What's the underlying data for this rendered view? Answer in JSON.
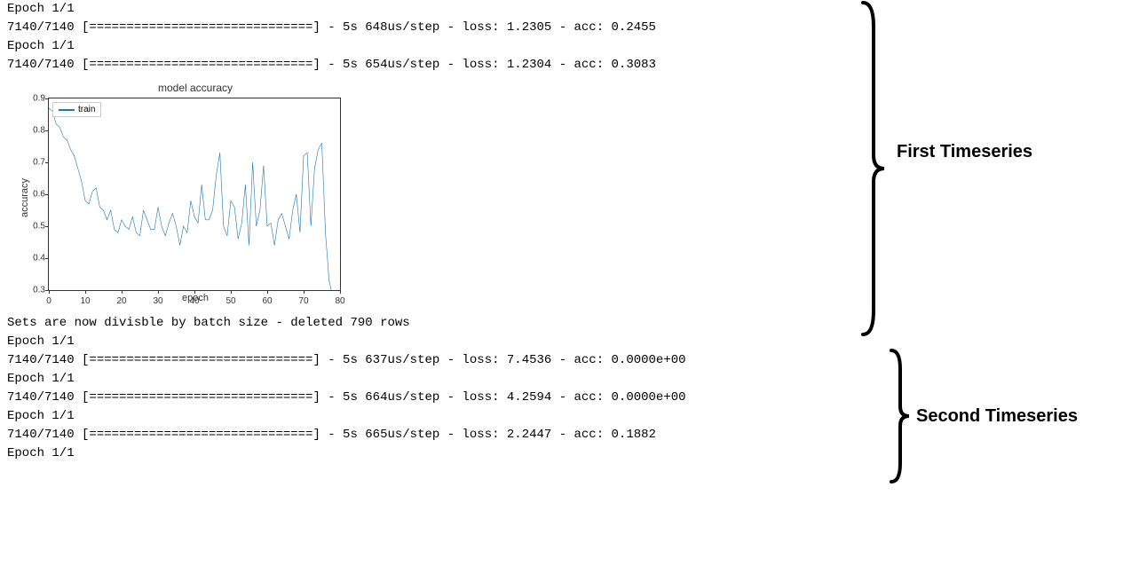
{
  "console": {
    "first_ts": [
      "Epoch 1/1",
      "7140/7140 [==============================] - 5s 648us/step - loss: 1.2305 - acc: 0.2455",
      "Epoch 1/1",
      "7140/7140 [==============================] - 5s 654us/step - loss: 1.2304 - acc: 0.3083"
    ],
    "second_ts": [
      "Sets are now divisble by batch size - deleted 790 rows",
      "Epoch 1/1",
      "7140/7140 [==============================] - 5s 637us/step - loss: 7.4536 - acc: 0.0000e+00",
      "Epoch 1/1",
      "7140/7140 [==============================] - 5s 664us/step - loss: 4.2594 - acc: 0.0000e+00",
      "Epoch 1/1",
      "7140/7140 [==============================] - 5s 665us/step - loss: 2.2447 - acc: 0.1882",
      "Epoch 1/1"
    ]
  },
  "chart_data": {
    "type": "line",
    "title": "model accuracy",
    "xlabel": "epoch",
    "ylabel": "accuracy",
    "xlim": [
      0,
      80
    ],
    "ylim": [
      0.25,
      0.9
    ],
    "x_ticks": [
      0,
      10,
      20,
      30,
      40,
      50,
      60,
      70,
      80
    ],
    "y_ticks": [
      0.3,
      0.4,
      0.5,
      0.6,
      0.7,
      0.8,
      0.9
    ],
    "legend": [
      "train"
    ],
    "series": [
      {
        "name": "train",
        "x": [
          0,
          1,
          2,
          3,
          4,
          5,
          6,
          7,
          8,
          9,
          10,
          11,
          12,
          13,
          14,
          15,
          16,
          17,
          18,
          19,
          20,
          21,
          22,
          23,
          24,
          25,
          26,
          27,
          28,
          29,
          30,
          31,
          32,
          33,
          34,
          35,
          36,
          37,
          38,
          39,
          40,
          41,
          42,
          43,
          44,
          45,
          46,
          47,
          48,
          49,
          50,
          51,
          52,
          53,
          54,
          55,
          56,
          57,
          58,
          59,
          60,
          61,
          62,
          63,
          64,
          65,
          66,
          67,
          68,
          69,
          70,
          71,
          72,
          73,
          74,
          75,
          76,
          77,
          78,
          79,
          80
        ],
        "values": [
          0.87,
          0.86,
          0.82,
          0.81,
          0.78,
          0.77,
          0.74,
          0.72,
          0.68,
          0.64,
          0.58,
          0.57,
          0.61,
          0.62,
          0.56,
          0.55,
          0.52,
          0.55,
          0.49,
          0.48,
          0.52,
          0.5,
          0.49,
          0.53,
          0.48,
          0.47,
          0.55,
          0.52,
          0.49,
          0.49,
          0.56,
          0.5,
          0.47,
          0.51,
          0.54,
          0.5,
          0.44,
          0.5,
          0.48,
          0.58,
          0.53,
          0.51,
          0.63,
          0.52,
          0.52,
          0.55,
          0.66,
          0.73,
          0.5,
          0.47,
          0.58,
          0.56,
          0.46,
          0.51,
          0.63,
          0.44,
          0.7,
          0.5,
          0.55,
          0.69,
          0.5,
          0.51,
          0.44,
          0.52,
          0.54,
          0.5,
          0.46,
          0.55,
          0.6,
          0.48,
          0.72,
          0.73,
          0.5,
          0.68,
          0.74,
          0.76,
          0.48,
          0.33,
          0.28,
          0.25,
          0.26
        ]
      }
    ]
  },
  "brackets": {
    "first": "First Timeseries",
    "second": "Second Timeseries"
  }
}
